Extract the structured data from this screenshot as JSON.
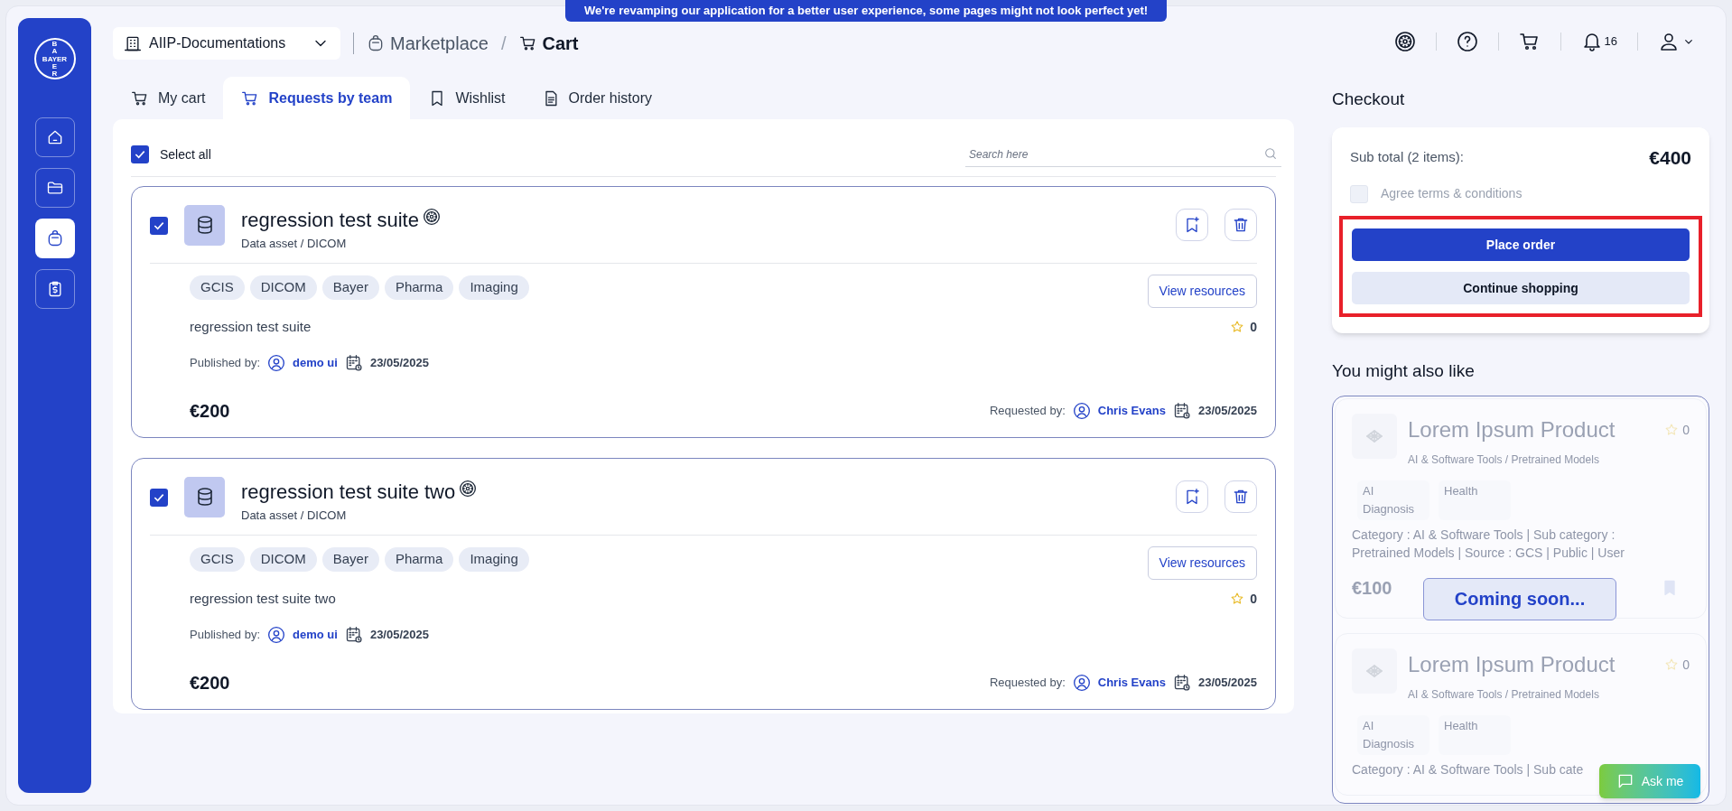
{
  "banner": "We're revamping our application for a better user experience, some pages might not look perfect yet!",
  "logo": {
    "horizontal": "BAYER",
    "vertical_top": "BA",
    "vertical_bottom": "ER"
  },
  "sidebar": {
    "items": [
      {
        "kind": "home",
        "selected": false
      },
      {
        "kind": "folder",
        "selected": false
      },
      {
        "kind": "bag",
        "selected": true
      },
      {
        "kind": "clipboard",
        "selected": false
      }
    ]
  },
  "workspace_select": {
    "value": "AIIP-Documentations"
  },
  "breadcrumb_separator": "/",
  "breadcrumb": [
    {
      "kind": "bag",
      "label": "Marketplace",
      "current": false
    },
    {
      "kind": "cart",
      "label": "Cart",
      "current": true
    }
  ],
  "header": {
    "notification_count": "16"
  },
  "tabs": [
    {
      "kind": "cart",
      "label": "My cart",
      "selected": false
    },
    {
      "kind": "cart",
      "label": "Requests by team",
      "selected": true
    },
    {
      "kind": "bookmark",
      "label": "Wishlist",
      "selected": false
    },
    {
      "kind": "document",
      "label": "Order history",
      "selected": false
    }
  ],
  "select_all": {
    "label": "Select all",
    "checked": true
  },
  "search": {
    "placeholder": "Search here"
  },
  "cart_items": [
    {
      "checked": true,
      "title": "regression test suite",
      "subtitle": "Data asset / DICOM",
      "tags": [
        "GCIS",
        "DICOM",
        "Bayer",
        "Pharma",
        "Imaging"
      ],
      "description": "regression test suite",
      "published_label": "Published by:",
      "publisher": "demo ui",
      "published_date": "23/05/2025",
      "view_button": "View resources",
      "rating": "0",
      "price": "€200",
      "requested_label": "Requested by:",
      "requester": "Chris Evans",
      "requested_date": "23/05/2025"
    },
    {
      "checked": true,
      "title": "regression test suite two",
      "subtitle": "Data asset / DICOM",
      "tags": [
        "GCIS",
        "DICOM",
        "Bayer",
        "Pharma",
        "Imaging"
      ],
      "description": "regression test suite two",
      "published_label": "Published by:",
      "publisher": "demo ui",
      "published_date": "23/05/2025",
      "view_button": "View resources",
      "rating": "0",
      "price": "€200",
      "requested_label": "Requested by:",
      "requester": "Chris Evans",
      "requested_date": "23/05/2025"
    }
  ],
  "checkout": {
    "title": "Checkout",
    "subtotal_label": "Sub total (2 items):",
    "subtotal": "€400",
    "agree": {
      "label": "Agree terms & conditions",
      "checked": false
    },
    "place_order": "Place order",
    "continue_shopping": "Continue shopping",
    "highlighted": true
  },
  "recommendations": {
    "title": "You might also like",
    "overlay": "Coming soon...",
    "products": [
      {
        "title": "Lorem Ipsum Product",
        "rating": "0",
        "subtitle": "AI & Software Tools / Pretrained Models",
        "tags": [
          "AI Diagnosis",
          "Health"
        ],
        "details": "Category : AI & Software Tools | Sub category : Pretrained Models | Source : GCS | Public | User",
        "price": "€100"
      },
      {
        "title": "Lorem Ipsum Product",
        "rating": "0",
        "subtitle": "AI & Software Tools / Pretrained Models",
        "tags": [
          "AI Diagnosis",
          "Health"
        ],
        "details": "Category : AI & Software Tools | Sub cate"
      }
    ]
  },
  "chat_button": "Ask me"
}
